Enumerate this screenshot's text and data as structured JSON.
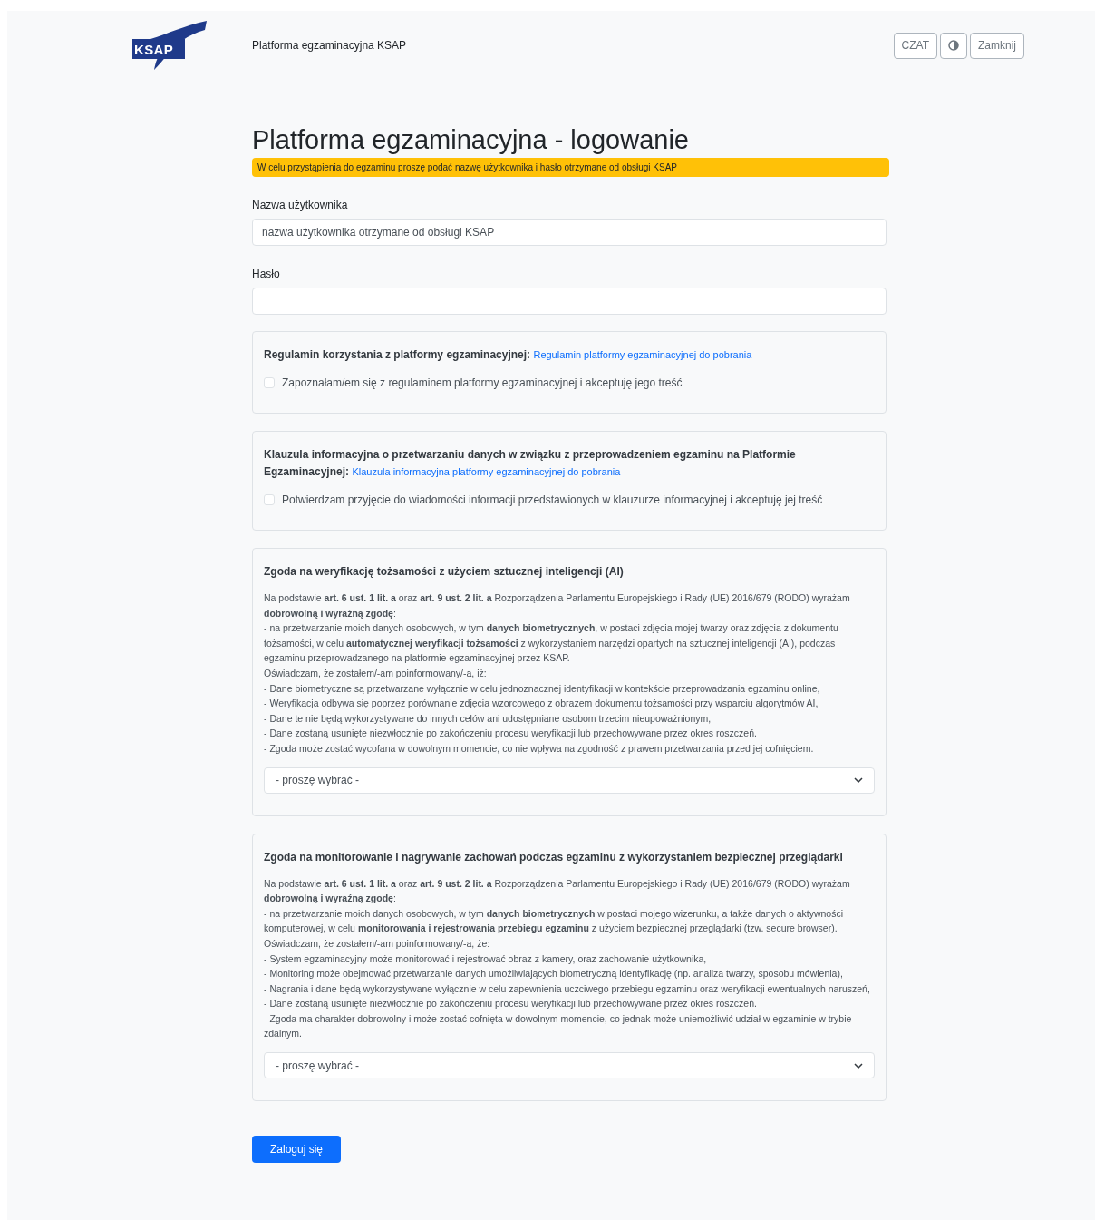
{
  "header": {
    "logo_text": "KSAP",
    "title": "Platforma egzaminacyjna KSAP",
    "buttons": [
      {
        "kind": "text",
        "label": "CZAT"
      },
      {
        "kind": "contrast"
      },
      {
        "kind": "text",
        "label": "Zamknij"
      }
    ]
  },
  "heading": "Platforma egzaminacyjna - logowanie",
  "alert": "W celu przystąpienia do egzaminu proszę podać nazwę użytkownika i hasło otrzymane od obsługi KSAP",
  "fields": [
    {
      "label": "Nazwa użytkownika",
      "placeholder": "nazwa użytkownika otrzymane od obsługi KSAP"
    },
    {
      "label": "Hasło"
    }
  ],
  "sections": [
    {
      "kind": "checkbox",
      "title": "Regulamin korzystania z platformy egzaminacyjnej:",
      "link": "Regulamin platformy egzaminacyjnej do pobrania",
      "checkbox": {
        "label": "Zapoznałam/em się z regulaminem platformy egzaminacyjnej i akceptuję jego treść",
        "checked": false
      }
    },
    {
      "kind": "checkbox",
      "title": "Klauzula informacyjna o przetwarzaniu danych w związku z przeprowadzeniem egzaminu na Platformie Egzaminacyjnej:",
      "link": "Klauzula informacyjna platformy egzaminacyjnej do pobrania",
      "checkbox": {
        "label": "Potwierdzam przyjęcie do wiadomości informacji przedstawionych w klauzurze informacyjnej i akceptuję jej treść",
        "checked": false
      }
    },
    {
      "kind": "consent",
      "title": "Zgoda na weryfikację tożsamości z użyciem sztucznej inteligencji (AI)",
      "lines": [
        "Na podstawie **art. 6 ust. 1 lit. a** oraz **art. 9 ust. 2 lit. a** Rozporządzenia Parlamentu Europejskiego i Rady (UE) 2016/679 (RODO) wyrażam **dobrowolną i wyraźną zgodę**:",
        "- na przetwarzanie moich danych osobowych, w tym **danych biometrycznych**, w postaci zdjęcia mojej twarzy oraz zdjęcia z dokumentu tożsamości, w celu **automatycznej weryfikacji tożsamości** z wykorzystaniem narzędzi opartych na sztucznej inteligencji (AI), podczas egzaminu przeprowadzanego na platformie egzaminacyjnej przez KSAP.",
        "Oświadczam, że zostałem/-am poinformowany/-a, iż:",
        "- Dane biometryczne są przetwarzane wyłącznie w celu jednoznacznej identyfikacji w kontekście przeprowadzania egzaminu online,",
        "- Weryfikacja odbywa się poprzez porównanie zdjęcia wzorcowego z obrazem dokumentu tożsamości przy wsparciu algorytmów AI,",
        "- Dane te nie będą wykorzystywane do innych celów ani udostępniane osobom trzecim nieupoważnionym,",
        "- Dane zostaną usunięte niezwłocznie po zakończeniu procesu weryfikacji lub przechowywane przez okres roszczeń.",
        "- Zgoda może zostać wycofana w dowolnym momencie, co nie wpływa na zgodność z prawem przetwarzania przed jej cofnięciem."
      ],
      "select": "- proszę wybrać -"
    },
    {
      "kind": "consent",
      "title": "Zgoda na monitorowanie i nagrywanie zachowań podczas egzaminu z wykorzystaniem bezpiecznej przeglądarki",
      "lines": [
        "Na podstawie **art. 6 ust. 1 lit. a** oraz **art. 9 ust. 2 lit. a** Rozporządzenia Parlamentu Europejskiego i Rady (UE) 2016/679 (RODO) wyrażam **dobrowolną i wyraźną zgodę**:",
        "- na przetwarzanie moich danych osobowych, w tym **danych biometrycznych** w postaci mojego wizerunku, a także danych o aktywności komputerowej, w celu **monitorowania i rejestrowania przebiegu egzaminu** z użyciem bezpiecznej przeglądarki (tzw. secure browser).",
        "Oświadczam, że zostałem/-am poinformowany/-a, że:",
        "- System egzaminacyjny może monitorować i rejestrować obraz z kamery, oraz zachowanie użytkownika,",
        "- Monitoring może obejmować przetwarzanie danych umożliwiających biometryczną identyfikację (np. analiza twarzy, sposobu mówienia),",
        "- Nagrania i dane będą wykorzystywane wyłącznie w celu zapewnienia uczciwego przebiegu egzaminu oraz weryfikacji ewentualnych naruszeń,",
        "- Dane zostaną usunięte niezwłocznie po zakończeniu procesu weryfikacji lub przechowywane przez okres roszczeń.",
        "- Zgoda ma charakter dobrowolny i może zostać cofnięta w dowolnym momencie, co jednak może uniemożliwić udział w egzaminie w trybie zdalnym."
      ],
      "select": "- proszę wybrać -"
    }
  ],
  "submit": "Zaloguj się"
}
